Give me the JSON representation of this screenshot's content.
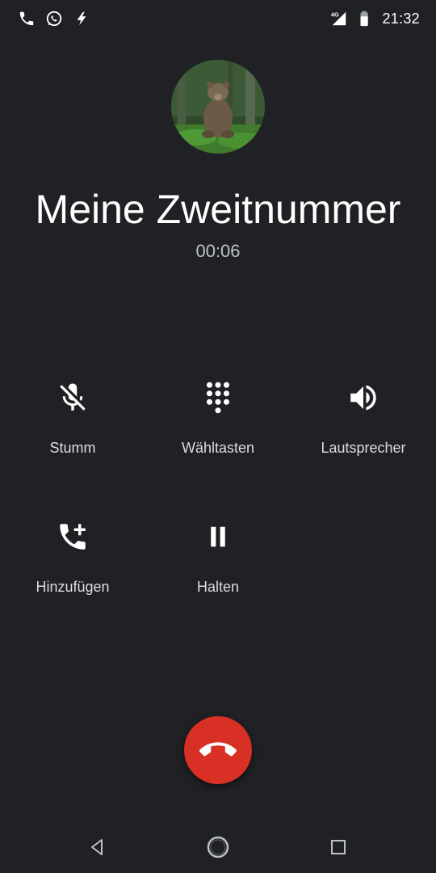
{
  "status_bar": {
    "time": "21:32",
    "network": "4G",
    "icons": [
      "phone-icon",
      "whatsapp-icon",
      "flash-icon",
      "signal-icon",
      "battery-icon"
    ]
  },
  "call": {
    "contact_name": "Meine Zweitnummer",
    "duration": "00:06",
    "avatar": "bear-photo"
  },
  "actions": {
    "mute": "Stumm",
    "dialpad": "Wähltasten",
    "speaker": "Lautsprecher",
    "add": "Hinzufügen",
    "hold": "Halten"
  },
  "colors": {
    "background": "#202124",
    "end_call": "#d93025"
  }
}
